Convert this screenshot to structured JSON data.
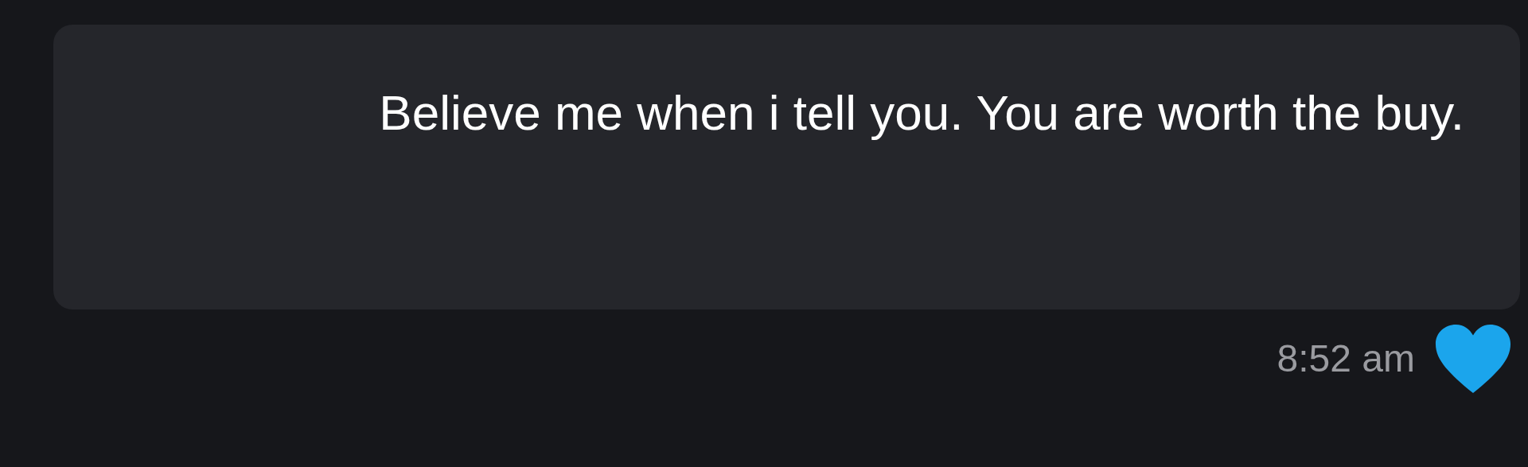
{
  "message": {
    "text": "Believe me when i tell you. You are worth the buy.",
    "time": "8:52 am",
    "liked": true
  }
}
